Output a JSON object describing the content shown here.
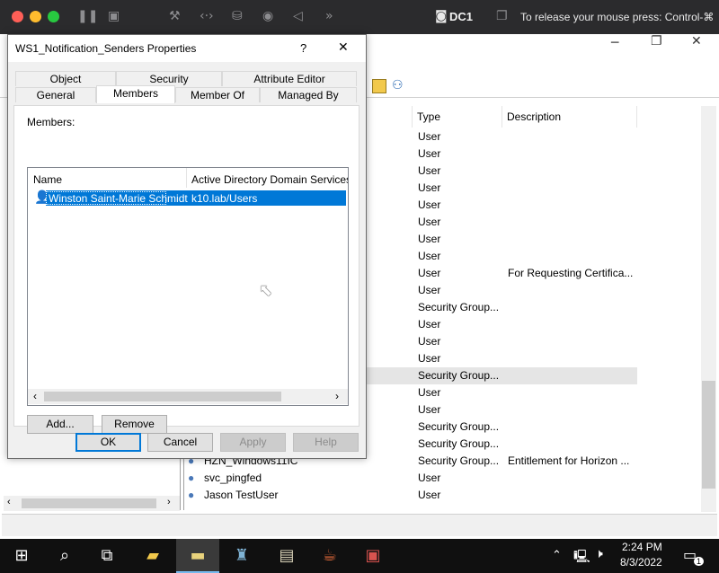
{
  "mac_bar": {
    "vm_name": "DC1",
    "release_hint": "To release your mouse press: Control-⌘"
  },
  "aduc": {
    "columns": {
      "type": "Type",
      "description": "Description"
    },
    "rows": [
      {
        "name": "",
        "type": "User",
        "description": ""
      },
      {
        "name": "",
        "type": "User",
        "description": ""
      },
      {
        "name": "",
        "type": "User",
        "description": ""
      },
      {
        "name": "",
        "type": "User",
        "description": ""
      },
      {
        "name": "",
        "type": "User",
        "description": ""
      },
      {
        "name": "",
        "type": "User",
        "description": ""
      },
      {
        "name": "",
        "type": "User",
        "description": ""
      },
      {
        "name": "",
        "type": "User",
        "description": ""
      },
      {
        "name": "",
        "type": "User",
        "description": "For Requesting Certifica..."
      },
      {
        "name": "",
        "type": "User",
        "description": ""
      },
      {
        "name": "",
        "type": "Security Group...",
        "description": ""
      },
      {
        "name": "",
        "type": "User",
        "description": ""
      },
      {
        "name": "",
        "type": "User",
        "description": ""
      },
      {
        "name": "",
        "type": "User",
        "description": ""
      },
      {
        "name": "",
        "type": "Security Group...",
        "description": ""
      },
      {
        "name": "",
        "type": "User",
        "description": ""
      },
      {
        "name": "",
        "type": "User",
        "description": ""
      },
      {
        "name": "",
        "type": "Security Group...",
        "description": ""
      },
      {
        "name": "",
        "type": "Security Group...",
        "description": ""
      },
      {
        "name": "HZN_Windows11IC",
        "type": "Security Group...",
        "description": "Entitlement for Horizon ..."
      },
      {
        "name": "svc_pingfed",
        "type": "User",
        "description": ""
      },
      {
        "name": "Jason TestUser",
        "type": "User",
        "description": ""
      }
    ]
  },
  "dialog": {
    "title": "WS1_Notification_Senders Properties",
    "help": "?",
    "close": "✕",
    "tabs_row1": [
      "Object",
      "Security",
      "Attribute Editor"
    ],
    "tabs_row2": [
      "General",
      "Members",
      "Member Of",
      "Managed By"
    ],
    "members_label": "Members:",
    "list_headers": {
      "name": "Name",
      "folder": "Active Directory Domain Services Fo"
    },
    "members": [
      {
        "name": "Winston Saint-Marie Schmidt",
        "folder": "k10.lab/Users"
      }
    ],
    "add_label": "Add...",
    "remove_label": "Remove",
    "ok_label": "OK",
    "cancel_label": "Cancel",
    "apply_label": "Apply",
    "help_label": "Help"
  },
  "taskbar": {
    "time": "2:24 PM",
    "date": "8/3/2022",
    "notifications": "1"
  }
}
